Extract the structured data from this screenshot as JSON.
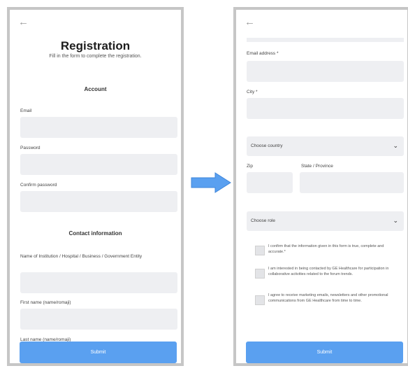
{
  "left_screen": {
    "back_icon": "arrow-left-icon",
    "title": "Registration",
    "subtitle": "Fill in the form to complete the registration.",
    "account_heading": "Account",
    "email_label": "Email",
    "password_label": "Password",
    "confirm_password_label": "Confirm password",
    "contact_heading": "Contact information",
    "institution_label": "Name of Institution / Hospital / Business / Government Entity",
    "first_name_label": "First name (name/romaji)",
    "last_name_label": "Last name (name/romaji)",
    "submit_label": "Submit"
  },
  "right_screen": {
    "back_icon": "arrow-left-icon",
    "email_address_label": "Email address *",
    "city_label": "City *",
    "country_select_value": "Choose country",
    "zip_label": "Zip",
    "state_label": "State / Province",
    "role_select_value": "Choose role",
    "checkbox_1_text": "I confirm that the information given in this form is true, complete and accurate.*",
    "checkbox_2_text": "I am interested in being contacted by GE Healthcare for participation in collaborative activities related to the forum trends.",
    "checkbox_3_text": "I agree to receive marketing emails, newsletters and other promotional communications from GE Healthcare from time to time.",
    "submit_label": "Submit"
  },
  "arrow": {
    "icon": "arrow-right-icon",
    "color": "#5aa0f0"
  },
  "colors": {
    "accent": "#5aa0f0",
    "field": "#eeeff2",
    "frame": "#c6c6c6"
  }
}
